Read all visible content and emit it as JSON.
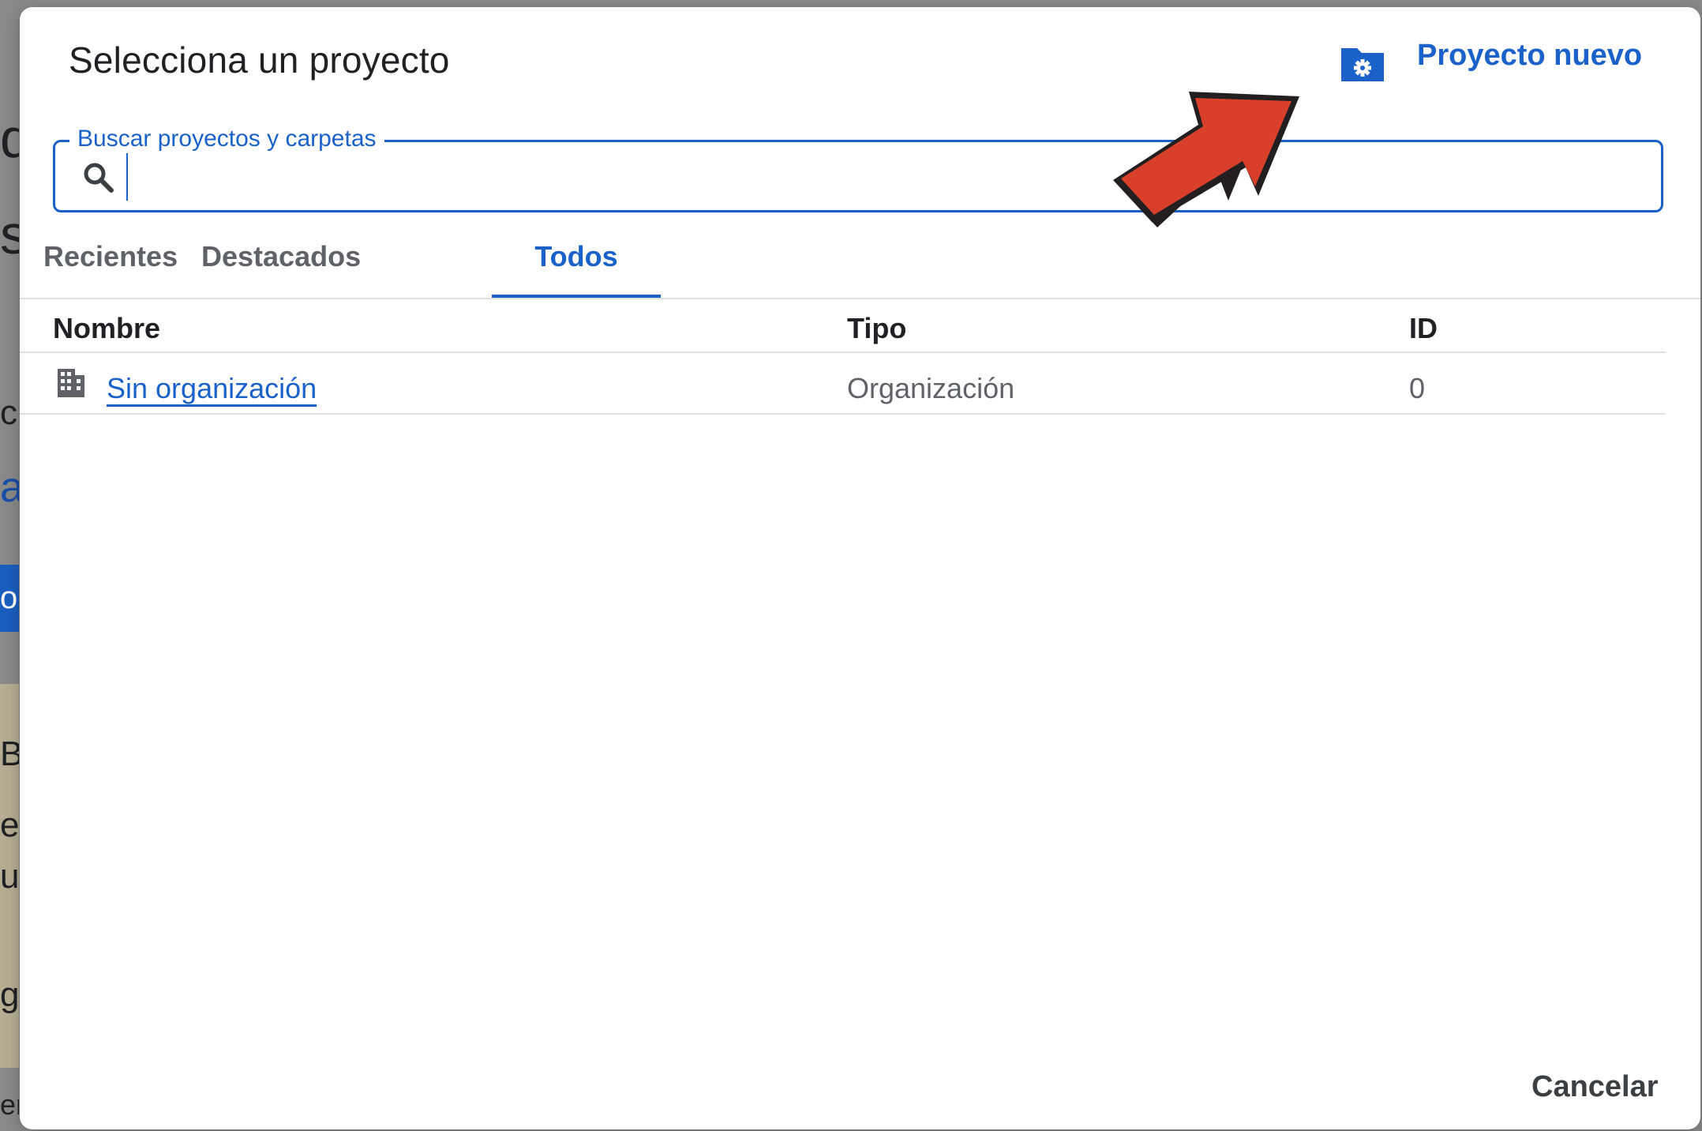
{
  "dialog": {
    "title": "Selecciona un proyecto",
    "new_project_label": "Proyecto nuevo",
    "search": {
      "label": "Buscar proyectos y carpetas",
      "value": ""
    },
    "tabs": [
      {
        "label": "Recientes",
        "active": false
      },
      {
        "label": "Destacados",
        "active": false
      },
      {
        "label": "Todos",
        "active": true
      }
    ],
    "table": {
      "columns": [
        "Nombre",
        "Tipo",
        "ID"
      ],
      "rows": [
        {
          "name": "Sin organización",
          "type": "Organización",
          "id": "0",
          "icon": "building-icon"
        }
      ]
    },
    "cancel_label": "Cancelar"
  },
  "colors": {
    "accent": "#1a61c9",
    "annotation_arrow": "#d9402b"
  }
}
